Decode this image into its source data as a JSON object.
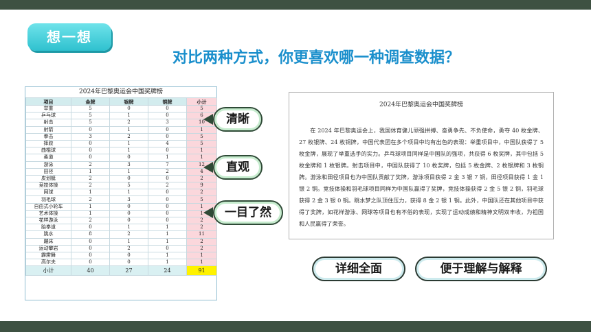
{
  "badge": "想一想",
  "title": "对比两种方式，你更喜欢哪一种调查数据？",
  "table": {
    "title": "2024年巴黎奥运会中国奖牌榜",
    "headers": [
      "项目",
      "金牌",
      "银牌",
      "铜牌",
      "小计"
    ],
    "rows": [
      [
        "举重",
        "5",
        "0",
        "0",
        "5"
      ],
      [
        "乒乓球",
        "5",
        "1",
        "0",
        "6"
      ],
      [
        "射击",
        "5",
        "2",
        "3",
        "10"
      ],
      [
        "射箭",
        "0",
        "1",
        "0",
        "1"
      ],
      [
        "拳击",
        "3",
        "2",
        "0",
        "5"
      ],
      [
        "摔跤",
        "0",
        "1",
        "4",
        "5"
      ],
      [
        "曲棍球",
        "0",
        "1",
        "0",
        "1"
      ],
      [
        "柔道",
        "0",
        "0",
        "1",
        "1"
      ],
      [
        "游泳",
        "2",
        "3",
        "7",
        "12"
      ],
      [
        "田径",
        "1",
        "1",
        "2",
        "4"
      ],
      [
        "皮划艇",
        "2",
        "0",
        "0",
        "2"
      ],
      [
        "竞技体操",
        "2",
        "5",
        "2",
        "9"
      ],
      [
        "网球",
        "1",
        "1",
        "0",
        "2"
      ],
      [
        "羽毛球",
        "2",
        "3",
        "0",
        "5"
      ],
      [
        "自由式小轮车",
        "1",
        "0",
        "0",
        "1"
      ],
      [
        "艺术体操",
        "1",
        "0",
        "0",
        "1"
      ],
      [
        "花样游泳",
        "2",
        "0",
        "0",
        "2"
      ],
      [
        "跆拳道",
        "0",
        "1",
        "1",
        "2"
      ],
      [
        "跳水",
        "8",
        "2",
        "1",
        "11"
      ],
      [
        "蹦床",
        "0",
        "1",
        "1",
        "2"
      ],
      [
        "运动攀岩",
        "0",
        "2",
        "0",
        "2"
      ],
      [
        "霹雳舞",
        "0",
        "0",
        "1",
        "1"
      ],
      [
        "高尔夫",
        "0",
        "0",
        "1",
        "1"
      ]
    ],
    "sum": [
      "小计",
      "40",
      "27",
      "24",
      "91"
    ]
  },
  "doc": {
    "title": "2024年巴黎奥运会中国奖牌榜",
    "body": "在 2024 年巴黎奥运会上，我国体育健儿顽强拼搏、奋勇争先、不负使命，勇夺 40 枚金牌、27 枚银牌、24 枚铜牌，中国代表团在多个项目中均有出色的表现：举重项目中，中国队获得了 5 枚金牌，展现了举重选手的实力。乒乓球项目同样是中国队的强项，共获得 6 枚奖牌，其中包括 5 枚金牌和 1 枚银牌。射击项目中，中国队获得了 10 枚奖牌，包括 5 枚金牌、2 枚银牌和 3 枚铜牌。游泳和田径项目也为中国队贡献了奖牌，游泳项目获得 2 金 3 银 7 铜，田径项目获得 1 金 1 银 2 铜。竞技体操和羽毛球项目同样为中国队赢得了奖牌，竞技体操获得 2 金 5 银 2 铜，羽毛球获得 2 金 3 银 0 铜。跳水梦之队顶住压力，获得 8 金 2 银 1 铜。此外，中国队还在其他项目中获得了奖牌，如花样游泳、网球等项目也有不俗的表现，实现了运动成绩和精神文明双丰收，为祖国和人民赢得了荣誉。"
  },
  "tags": {
    "clear": "清晰",
    "intuitive": "直观",
    "at_a_glance": "一目了然",
    "detailed": "详细全面",
    "easy": "便于理解与解释"
  }
}
